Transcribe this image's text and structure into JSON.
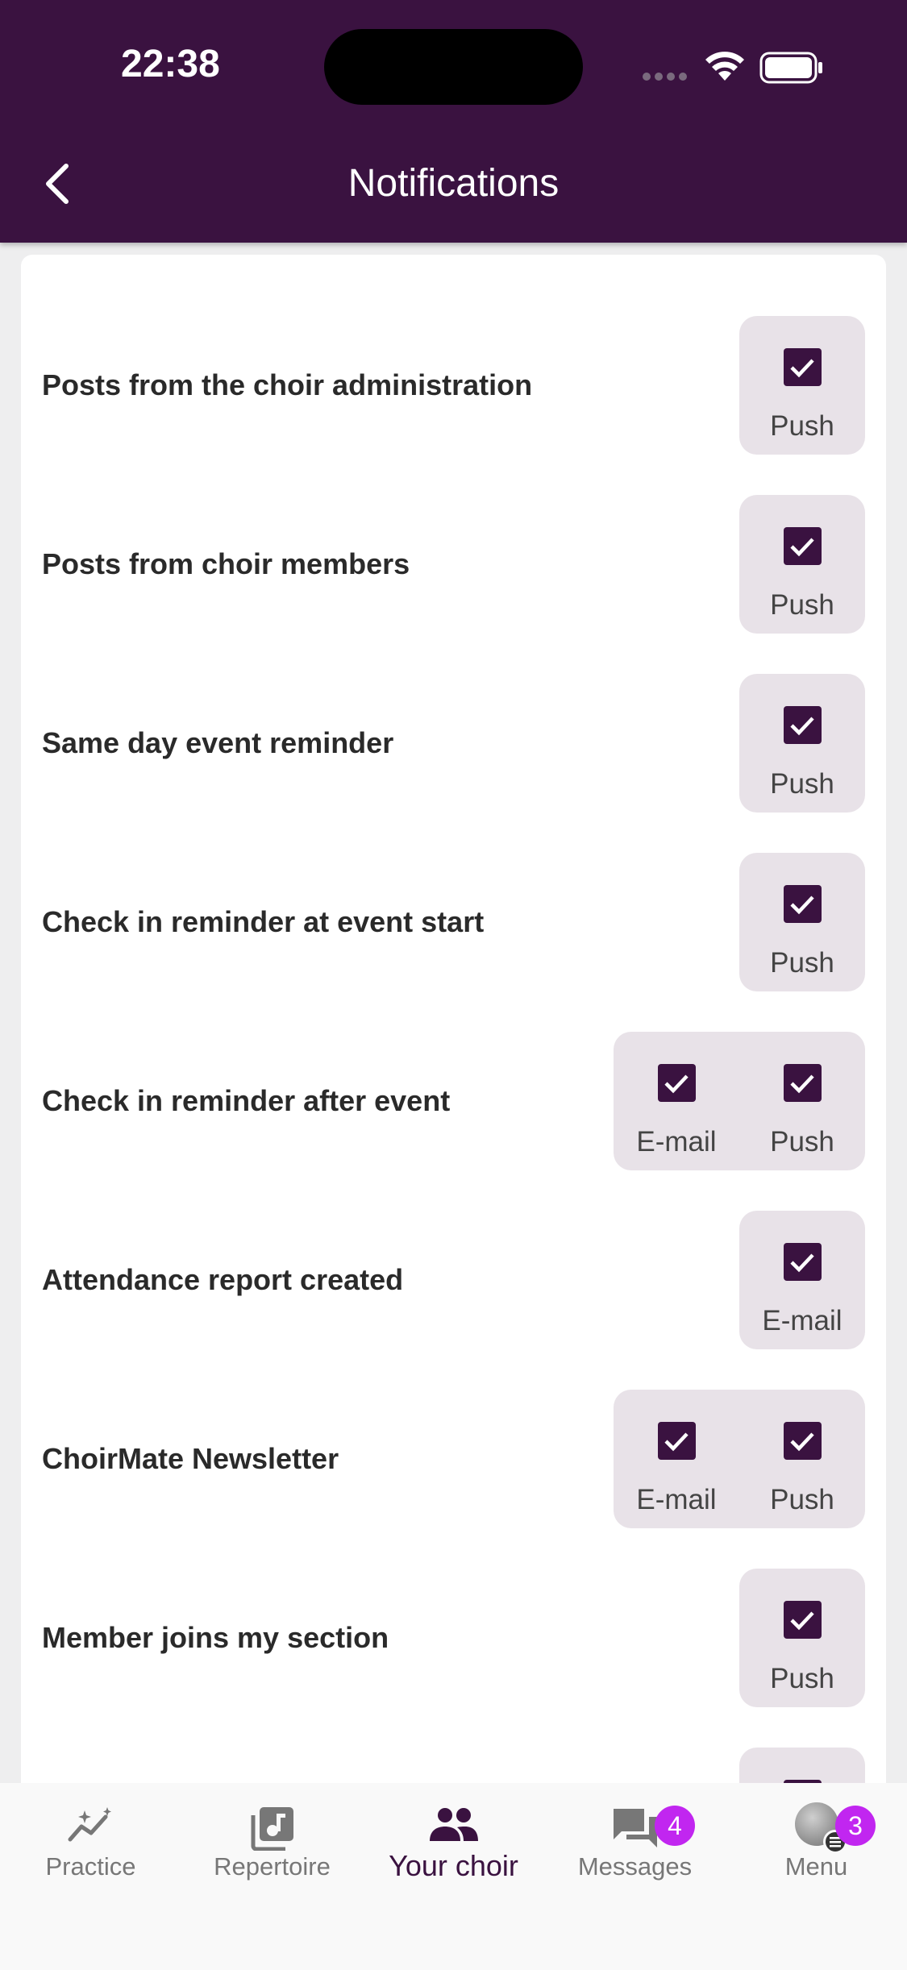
{
  "status_bar": {
    "time": "22:38"
  },
  "header": {
    "title": "Notifications"
  },
  "settings": [
    {
      "label": "Posts from the choir administration",
      "options": [
        {
          "label": "Push",
          "checked": true
        }
      ]
    },
    {
      "label": "Posts from choir members",
      "options": [
        {
          "label": "Push",
          "checked": true
        }
      ]
    },
    {
      "label": "Same day event reminder",
      "options": [
        {
          "label": "Push",
          "checked": true
        }
      ]
    },
    {
      "label": "Check in reminder at event start",
      "options": [
        {
          "label": "Push",
          "checked": true
        }
      ]
    },
    {
      "label": "Check in reminder after event",
      "options": [
        {
          "label": "E-mail",
          "checked": true
        },
        {
          "label": "Push",
          "checked": true
        }
      ]
    },
    {
      "label": "Attendance report created",
      "options": [
        {
          "label": "E-mail",
          "checked": true
        }
      ]
    },
    {
      "label": "ChoirMate Newsletter",
      "options": [
        {
          "label": "E-mail",
          "checked": true
        },
        {
          "label": "Push",
          "checked": true
        }
      ]
    },
    {
      "label": "Member joins my section",
      "options": [
        {
          "label": "Push",
          "checked": true
        }
      ]
    }
  ],
  "bottom_nav": {
    "items": [
      {
        "label": "Practice",
        "icon": "practice-chart-icon"
      },
      {
        "label": "Repertoire",
        "icon": "music-library-icon"
      },
      {
        "label": "Your choir",
        "icon": "people-icon",
        "active": true
      },
      {
        "label": "Messages",
        "icon": "chat-bubbles-icon",
        "badge": "4"
      },
      {
        "label": "Menu",
        "icon": "avatar",
        "badge": "3"
      }
    ]
  },
  "colors": {
    "primary": "#3a1240",
    "badge": "#c126f0",
    "option_bg": "#e8e2e8"
  }
}
